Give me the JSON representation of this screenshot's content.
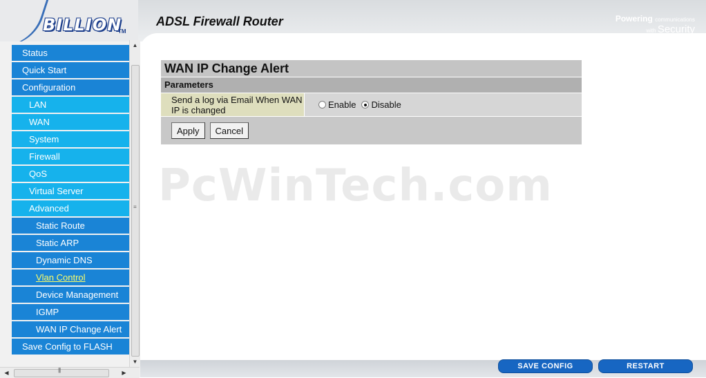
{
  "header": {
    "logo": "BILLION",
    "logo_tm": "TM",
    "product_title": "ADSL Firewall Router",
    "tagline_powering": "Powering",
    "tagline_communications": "communications",
    "tagline_with": "with",
    "tagline_security": "Security"
  },
  "sidebar": {
    "items": [
      {
        "label": "Status",
        "level": 0
      },
      {
        "label": "Quick Start",
        "level": 0
      },
      {
        "label": "Configuration",
        "level": 0
      },
      {
        "label": "LAN",
        "level": 1
      },
      {
        "label": "WAN",
        "level": 1
      },
      {
        "label": "System",
        "level": 1
      },
      {
        "label": "Firewall",
        "level": 1
      },
      {
        "label": "QoS",
        "level": 1
      },
      {
        "label": "Virtual Server",
        "level": 1
      },
      {
        "label": "Advanced",
        "level": 1
      },
      {
        "label": "Static Route",
        "level": 2
      },
      {
        "label": "Static ARP",
        "level": 2
      },
      {
        "label": "Dynamic DNS",
        "level": 2
      },
      {
        "label": "Vlan Control",
        "level": 2,
        "highlighted": true
      },
      {
        "label": "Device Management",
        "level": 2
      },
      {
        "label": "IGMP",
        "level": 2
      },
      {
        "label": "WAN IP Change Alert",
        "level": 2
      },
      {
        "label": "Save Config to FLASH",
        "level": 0
      }
    ]
  },
  "main": {
    "title": "WAN IP Change Alert",
    "section": "Parameters",
    "field_label": "Send a log via Email When WAN IP is changed",
    "options": {
      "enable": "Enable",
      "disable": "Disable",
      "selected": "Disable"
    },
    "apply_label": "Apply",
    "cancel_label": "Cancel"
  },
  "watermark": "PcWinTech.com",
  "footer": {
    "save_label": "SAVE CONFIG",
    "restart_label": "RESTART"
  },
  "colors": {
    "menu_level0": "#1a84d6",
    "menu_level1": "#16b2ec",
    "menu_level2": "#1a84d6",
    "highlight_link": "#ffff66",
    "footer_button": "#1766c2"
  }
}
